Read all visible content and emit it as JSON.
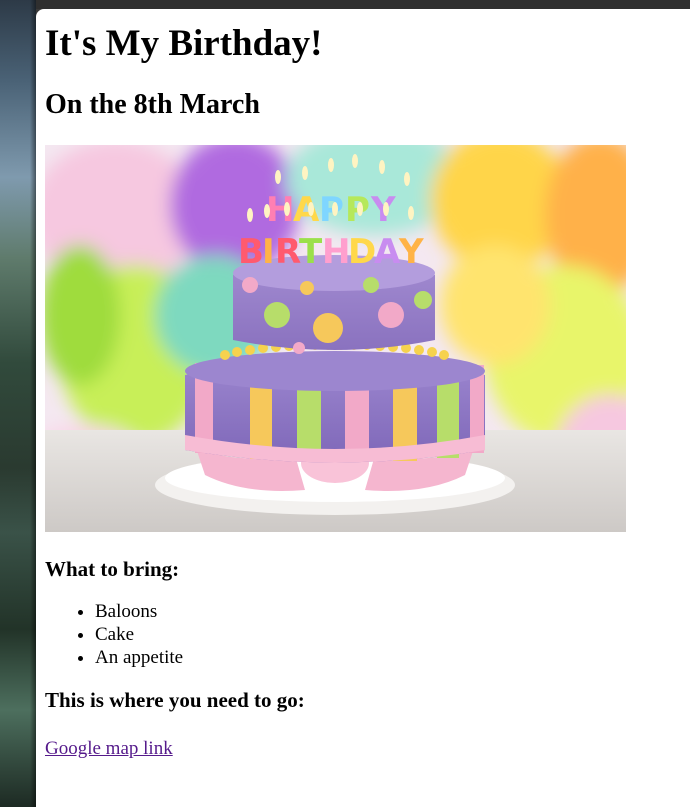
{
  "page": {
    "title": "It's My Birthday!",
    "date_heading": "On the 8th March",
    "image": {
      "cake_text_top": "HAPPY",
      "cake_text_bottom": "BIRTHDAY"
    },
    "bring": {
      "heading": "What to bring:",
      "items": [
        "Baloons",
        "Cake",
        "An appetite"
      ]
    },
    "where": {
      "heading": "This is where you need to go:",
      "link_label": "Google map link"
    }
  }
}
